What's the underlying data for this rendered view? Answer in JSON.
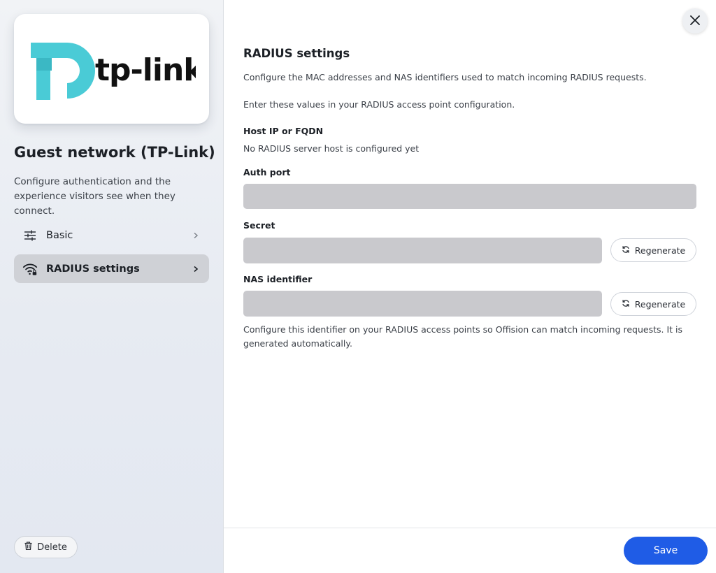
{
  "brand": {
    "logo_text": "tp-link",
    "logo_color": "#4acbd6"
  },
  "sidebar": {
    "title": "Guest network (TP-Link)",
    "description": "Configure authentication and the experience visitors see when they connect.",
    "items": [
      {
        "label": "Basic",
        "icon": "sliders-icon",
        "active": false
      },
      {
        "label": "RADIUS settings",
        "icon": "wifi-lock-icon",
        "active": true
      }
    ],
    "delete_label": "Delete"
  },
  "main": {
    "title": "RADIUS settings",
    "intro": "Configure the MAC addresses and NAS identifiers used to match incoming RADIUS requests.",
    "instruction": "Enter these values in your RADIUS access point configuration.",
    "host": {
      "label": "Host IP or FQDN",
      "value": "No RADIUS server host is configured yet"
    },
    "auth_port": {
      "label": "Auth port",
      "value": ""
    },
    "secret": {
      "label": "Secret",
      "value": "",
      "regenerate_label": "Regenerate"
    },
    "nas": {
      "label": "NAS identifier",
      "value": "",
      "regenerate_label": "Regenerate",
      "help": "Configure this identifier on your RADIUS access points so Offision can match incoming requests. It is generated automatically."
    }
  },
  "footer": {
    "save_label": "Save"
  },
  "colors": {
    "accent": "#1f5ce6",
    "field_bg": "#c9c9cd",
    "active_nav": "#cfd1d6"
  }
}
